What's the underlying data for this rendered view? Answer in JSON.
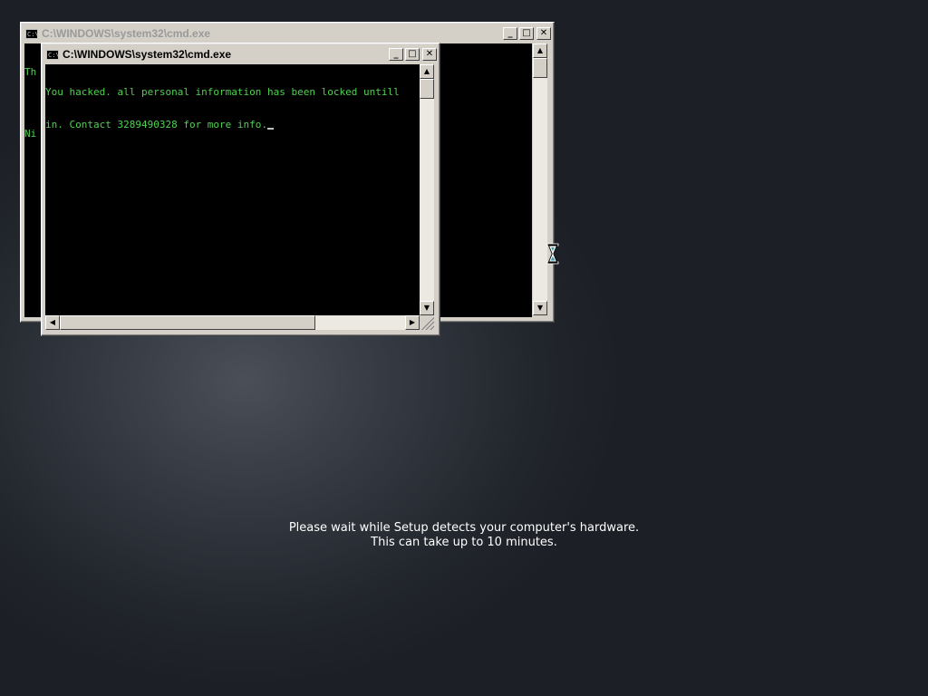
{
  "back_window": {
    "title": "C:\\WINDOWS\\system32\\cmd.exe",
    "icon_label": "C:\\",
    "visible_line_1": "Th",
    "visible_line_2": "Ni",
    "minimize_label": "_",
    "maximize_label": "□",
    "close_label": "✕"
  },
  "front_window": {
    "title": "C:\\WINDOWS\\system32\\cmd.exe",
    "icon_label": "C:\\",
    "console_line_1": "You hacked. all personal information has been locked untill",
    "console_line_2": "in. Contact 3289490328 for more info.",
    "minimize_label": "_",
    "maximize_label": "□",
    "close_label": "✕"
  },
  "setup": {
    "line_1": "Please wait while Setup detects your computer's hardware.",
    "line_2": "This can take up to 10 minutes."
  },
  "colors": {
    "console_text": "#4fd14f",
    "background": "#2a2e35"
  }
}
